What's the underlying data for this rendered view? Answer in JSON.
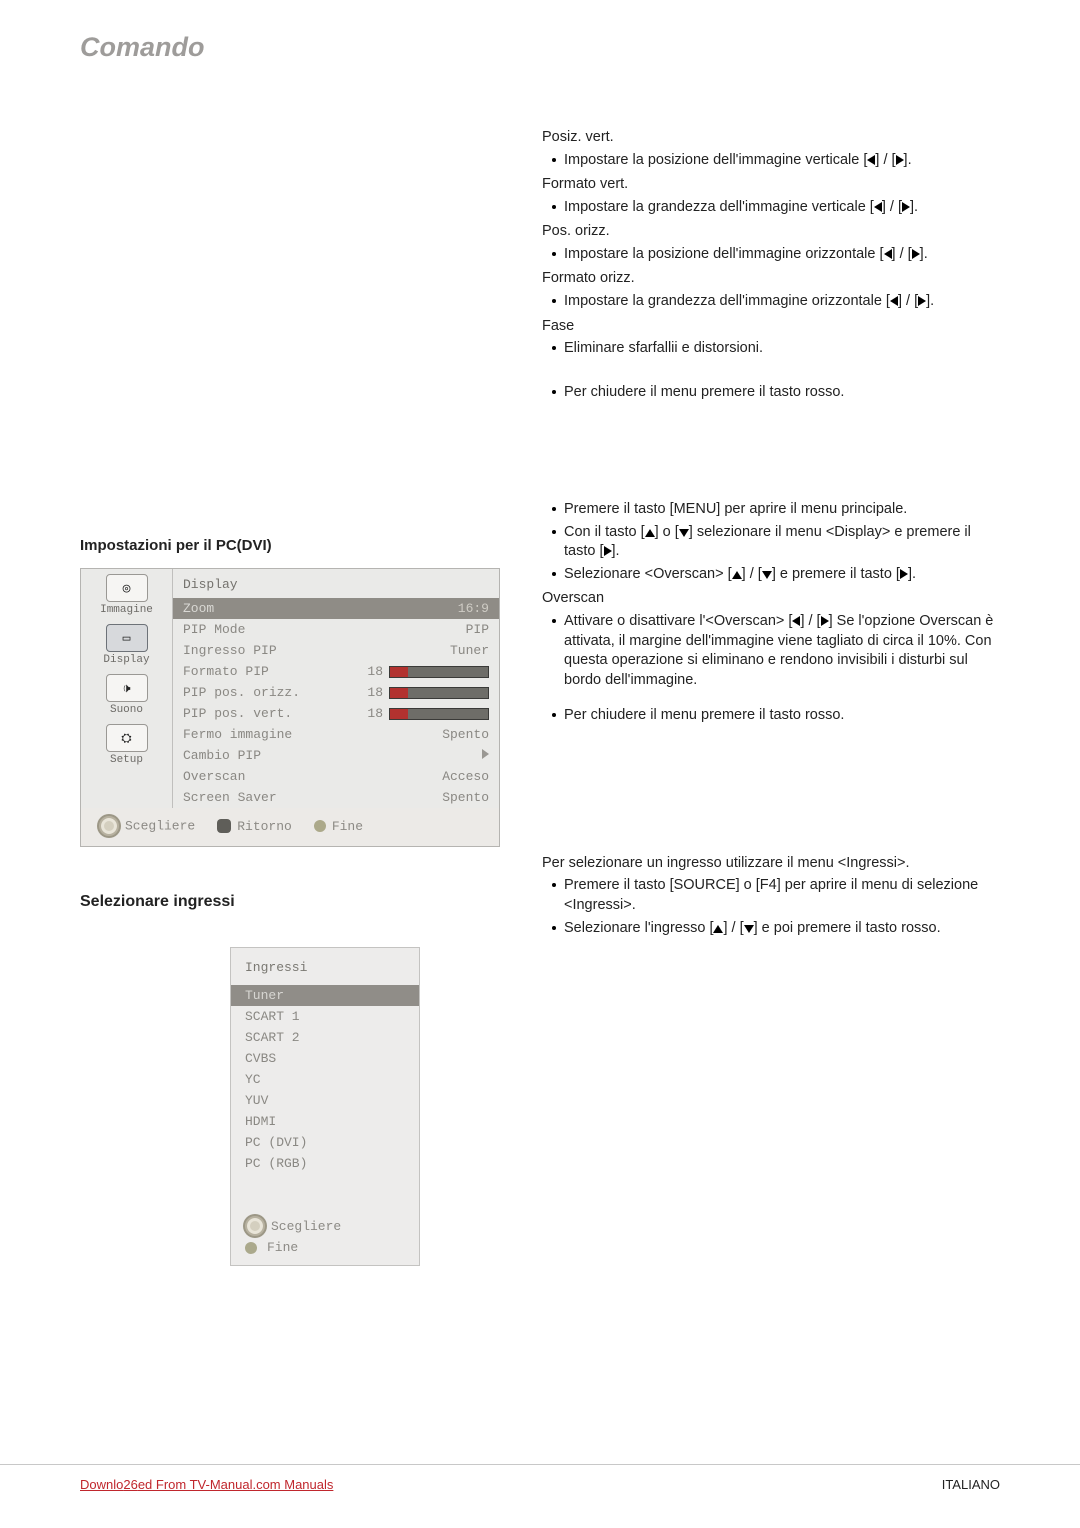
{
  "header": {
    "title": "Comando"
  },
  "left": {
    "section1_title": "Impostazioni per il PC(DVI)",
    "osd": {
      "title": "Display",
      "sidebar": [
        {
          "label": "Immagine"
        },
        {
          "label": "Display"
        },
        {
          "label": "Suono"
        },
        {
          "label": "Setup"
        }
      ],
      "rows": [
        {
          "label": "Zoom",
          "value": "16:9",
          "selected": true
        },
        {
          "label": "PIP Mode",
          "value": "PIP"
        },
        {
          "label": "Ingresso PIP",
          "value": "Tuner"
        },
        {
          "label": "Formato PIP",
          "slider": 18
        },
        {
          "label": "PIP pos. orizz.",
          "slider": 18
        },
        {
          "label": "PIP pos. vert.",
          "slider": 18
        },
        {
          "label": "Fermo immagine",
          "value": "Spento"
        },
        {
          "label": "Cambio PIP",
          "value_icon": "tri-right"
        },
        {
          "label": "Overscan",
          "value": "Acceso"
        },
        {
          "label": "Screen Saver",
          "value": "Spento"
        }
      ],
      "footer": {
        "scegliere": "Scegliere",
        "ritorno": "Ritorno",
        "fine": "Fine"
      }
    },
    "section2_title": "Selezionare ingressi",
    "osd2": {
      "title": "Ingressi",
      "rows": [
        {
          "label": "Tuner",
          "selected": true
        },
        {
          "label": "SCART 1"
        },
        {
          "label": "SCART 2"
        },
        {
          "label": "CVBS"
        },
        {
          "label": "YC"
        },
        {
          "label": "YUV"
        },
        {
          "label": "HDMI"
        },
        {
          "label": "PC (DVI)"
        },
        {
          "label": "PC (RGB)"
        }
      ],
      "footer": {
        "scegliere": "Scegliere",
        "fine": "Fine"
      }
    }
  },
  "right": {
    "blocks": [
      {
        "type": "para",
        "text": "Posiz. vert."
      },
      {
        "type": "bullet_arrow_lr",
        "text": "Impostare la posizione dell'immagine verticale "
      },
      {
        "type": "para",
        "text": "Formato vert."
      },
      {
        "type": "bullet_arrow_lr2",
        "text": "Impostare la grandezza dell'immagine verticale"
      },
      {
        "type": "para",
        "text": "Pos. orizz."
      },
      {
        "type": "bullet_arrow_lr2",
        "text": "Impostare la posizione dell'immagine orizzontale"
      },
      {
        "type": "para",
        "text": "Formato orizz."
      },
      {
        "type": "bullet_arrow_lr2",
        "text": "Impostare la grandezza dell'immagine orizzontale"
      },
      {
        "type": "para",
        "text": "Fase"
      },
      {
        "type": "bullet",
        "text": "Eliminare sfarfallii e distorsioni."
      },
      {
        "type": "gap18"
      },
      {
        "type": "bullet",
        "text": "Per chiudere il menu premere il tasto rosso."
      }
    ],
    "blocks2": [
      {
        "type": "bullet",
        "text": "Premere il tasto [MENU] per aprire il menu principale."
      },
      {
        "type": "bullet_menu",
        "text1": "Con il tasto ",
        "text2": " selezionare il menu <Display> e premere il tasto "
      },
      {
        "type": "bullet_updown_r",
        "text1": "Selezionare <Overscan> ",
        "text2": " e premere il tasto "
      },
      {
        "type": "para",
        "text": "Overscan"
      },
      {
        "type": "bullet_overscan",
        "text1": "Attivare o disattivare l'<Overscan> ",
        "text2": " Se l'opzione Overscan è attivata, il margine dell'immagine viene tagliato di circa il 10%. Con questa operazione si eliminano e rendono invisibili i disturbi sul bordo dell'immagine."
      },
      {
        "type": "gap10"
      },
      {
        "type": "bullet",
        "text": "Per chiudere il menu premere il tasto rosso."
      }
    ],
    "blocks3_intro": "Per selezionare un ingresso utilizzare il menu <Ingressi>.",
    "blocks3": [
      {
        "type": "bullet",
        "text": "Premere il tasto [SOURCE] o [F4] per aprire il menu di selezione <Ingressi>."
      },
      {
        "type": "bullet_updown_rosso",
        "text1": "Selezionare l'ingresso ",
        "text2": " e poi premere il tasto rosso."
      }
    ]
  },
  "footer": {
    "download_prefix": "Downlo",
    "download_num": "26",
    "download_suffix": "ed From TV-Manual.com Manuals",
    "lang": "ITALIANO"
  }
}
